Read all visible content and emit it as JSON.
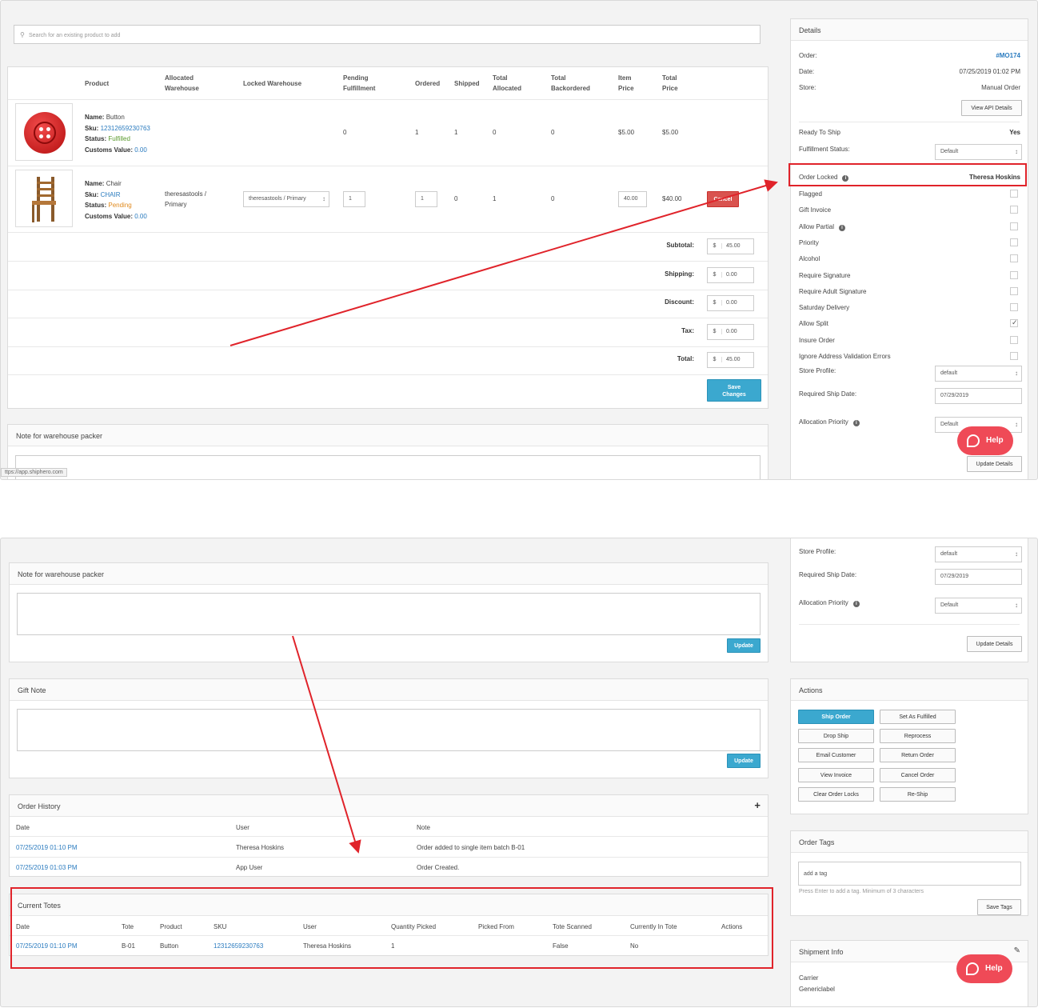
{
  "search": {
    "placeholder": "Search for an existing product to add"
  },
  "items_table": {
    "headers": {
      "product": "Product",
      "allocated_warehouse": [
        "Allocated",
        "Warehouse"
      ],
      "locked_warehouse": "Locked Warehouse",
      "pending_fulfillment": [
        "Pending",
        "Fulfillment"
      ],
      "ordered": "Ordered",
      "shipped": "Shipped",
      "total_allocated": [
        "Total",
        "Allocated"
      ],
      "total_backordered": [
        "Total",
        "Backordered"
      ],
      "item_price": [
        "Item",
        "Price"
      ],
      "total_price": [
        "Total",
        "Price"
      ]
    },
    "rows": [
      {
        "name_label": "Name:",
        "name": "Button",
        "sku_label": "Sku:",
        "sku": "12312659230763",
        "status_label": "Status:",
        "status": "Fulfilled",
        "customs_label": "Customs Value:",
        "customs": "0.00",
        "pending": "0",
        "ordered": "1",
        "shipped": "1",
        "allocated": "0",
        "backordered": "0",
        "item_price": "$5.00",
        "total_price": "$5.00"
      },
      {
        "name_label": "Name:",
        "name": "Chair",
        "sku_label": "Sku:",
        "sku": "CHAIR",
        "status_label": "Status:",
        "status": "Pending",
        "customs_label": "Customs Value:",
        "customs": "0.00",
        "allocated_wh": [
          "theresastools /",
          "Primary"
        ],
        "locked_wh": "theresastools / Primary",
        "pending": "1",
        "ordered": "1",
        "shipped": "0",
        "allocated": "1",
        "backordered": "0",
        "item_price": "40.00",
        "total_price": "$40.00",
        "cancel": "Cancel"
      }
    ],
    "totals": [
      {
        "label": "Subtotal:",
        "currency": "$",
        "value": "45.00"
      },
      {
        "label": "Shipping:",
        "currency": "$",
        "value": "0.00"
      },
      {
        "label": "Discount:",
        "currency": "$",
        "value": "0.00"
      },
      {
        "label": "Tax:",
        "currency": "$",
        "value": "0.00"
      },
      {
        "label": "Total:",
        "currency": "$",
        "value": "45.00"
      }
    ],
    "save": [
      "Save",
      "Changes"
    ]
  },
  "note_packer": {
    "title": "Note for warehouse packer",
    "update": "Update"
  },
  "status_url": "ttps://app.shiphero.com",
  "details": {
    "title": "Details",
    "order_label": "Order:",
    "order": "#MO174",
    "date_label": "Date:",
    "date": "07/25/2019 01:02 PM",
    "store_label": "Store:",
    "store": "Manual Order",
    "view_api": "View API Details",
    "ready_label": "Ready To Ship",
    "ready": "Yes",
    "fulfillment_label": "Fulfillment Status:",
    "fulfillment": "Default",
    "locked_label": "Order Locked",
    "locked": "Theresa Hoskins",
    "flags": [
      {
        "label": "Flagged",
        "checked": false
      },
      {
        "label": "Gift Invoice",
        "checked": false
      },
      {
        "label": "Allow Partial",
        "checked": false,
        "info": true
      },
      {
        "label": "Priority",
        "checked": false
      },
      {
        "label": "Alcohol",
        "checked": false
      },
      {
        "label": "Require Signature",
        "checked": false
      },
      {
        "label": "Require Adult Signature",
        "checked": false
      },
      {
        "label": "Saturday Delivery",
        "checked": false
      },
      {
        "label": "Allow Split",
        "checked": true
      },
      {
        "label": "Insure Order",
        "checked": false
      },
      {
        "label": "Ignore Address Validation Errors",
        "checked": false
      }
    ],
    "store_profile_label": "Store Profile:",
    "store_profile": "default",
    "ship_date_label": "Required Ship Date:",
    "ship_date": "07/29/2019",
    "alloc_label": "Allocation Priority",
    "alloc": "Default",
    "update": "Update Details"
  },
  "help": {
    "label": "Help",
    "check": "✓"
  },
  "gift_note": {
    "title": "Gift Note",
    "update": "Update"
  },
  "order_history": {
    "title": "Order History",
    "add": "+",
    "headers": [
      "Date",
      "User",
      "Note"
    ],
    "rows": [
      {
        "date": "07/25/2019 01:10 PM",
        "user": "Theresa Hoskins",
        "note": "Order added to single item batch B-01"
      },
      {
        "date": "07/25/2019 01:03 PM",
        "user": "App User",
        "note": "Order Created."
      }
    ]
  },
  "current_totes": {
    "title": "Current Totes",
    "headers": [
      "Date",
      "Tote",
      "Product",
      "SKU",
      "User",
      "Quantity Picked",
      "Picked From",
      "Tote Scanned",
      "Currently In Tote",
      "Actions"
    ],
    "rows": [
      {
        "date": "07/25/2019 01:10 PM",
        "tote": "B-01",
        "product": "Button",
        "sku": "12312659230763",
        "user": "Theresa Hoskins",
        "qty": "1",
        "from": "",
        "scanned": "False",
        "in_tote": "No",
        "actions": ""
      }
    ]
  },
  "actions": {
    "title": "Actions",
    "left": [
      "Ship Order",
      "Drop Ship",
      "Email Customer",
      "View Invoice",
      "Clear Order Locks"
    ],
    "right": [
      "Set As Fulfilled",
      "Reprocess",
      "Return Order",
      "Cancel Order",
      "Re-Ship"
    ]
  },
  "order_tags": {
    "title": "Order Tags",
    "placeholder": "add a tag",
    "hint": "Press Enter to add a tag. Minimum of 3 characters",
    "save": "Save Tags"
  },
  "shipment": {
    "title": "Shipment Info",
    "carrier_label": "Carrier",
    "carrier": "Genericlabel"
  },
  "colors": {
    "accent": "#3ba8cf",
    "link": "#2a7bbf",
    "danger": "#e0232a",
    "help": "#ef4a57"
  }
}
